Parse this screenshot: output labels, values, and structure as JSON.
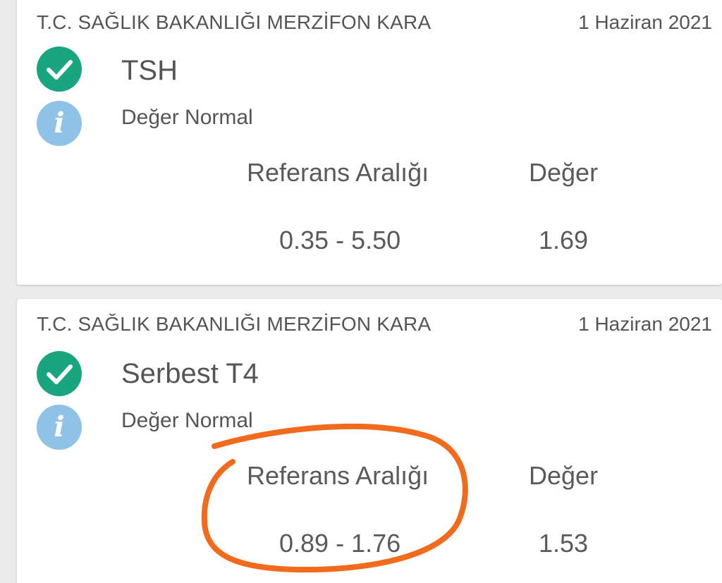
{
  "results": [
    {
      "institution": "T.C. SAĞLIK BAKANLIĞI MERZİFON KARA",
      "date": "1 Haziran 2021",
      "test_name": "TSH",
      "status": "Değer Normal",
      "reference_header": "Referans Aralığı",
      "value_header": "Değer",
      "reference_range": "0.35 - 5.50",
      "value": "1.69"
    },
    {
      "institution": "T.C. SAĞLIK BAKANLIĞI MERZİFON KARA",
      "date": "1 Haziran 2021",
      "test_name": "Serbest T4",
      "status": "Değer Normal",
      "reference_header": "Referans Aralığı",
      "value_header": "Değer",
      "reference_range": "0.89 - 1.76",
      "value": "1.53"
    }
  ],
  "icons": {
    "check": "check-circle-icon",
    "info": "info-circle-icon"
  },
  "colors": {
    "check_green": "#1aa581",
    "info_blue": "#8ec2e6",
    "annotation_orange": "#f26b1d",
    "text_gray": "#555555"
  }
}
